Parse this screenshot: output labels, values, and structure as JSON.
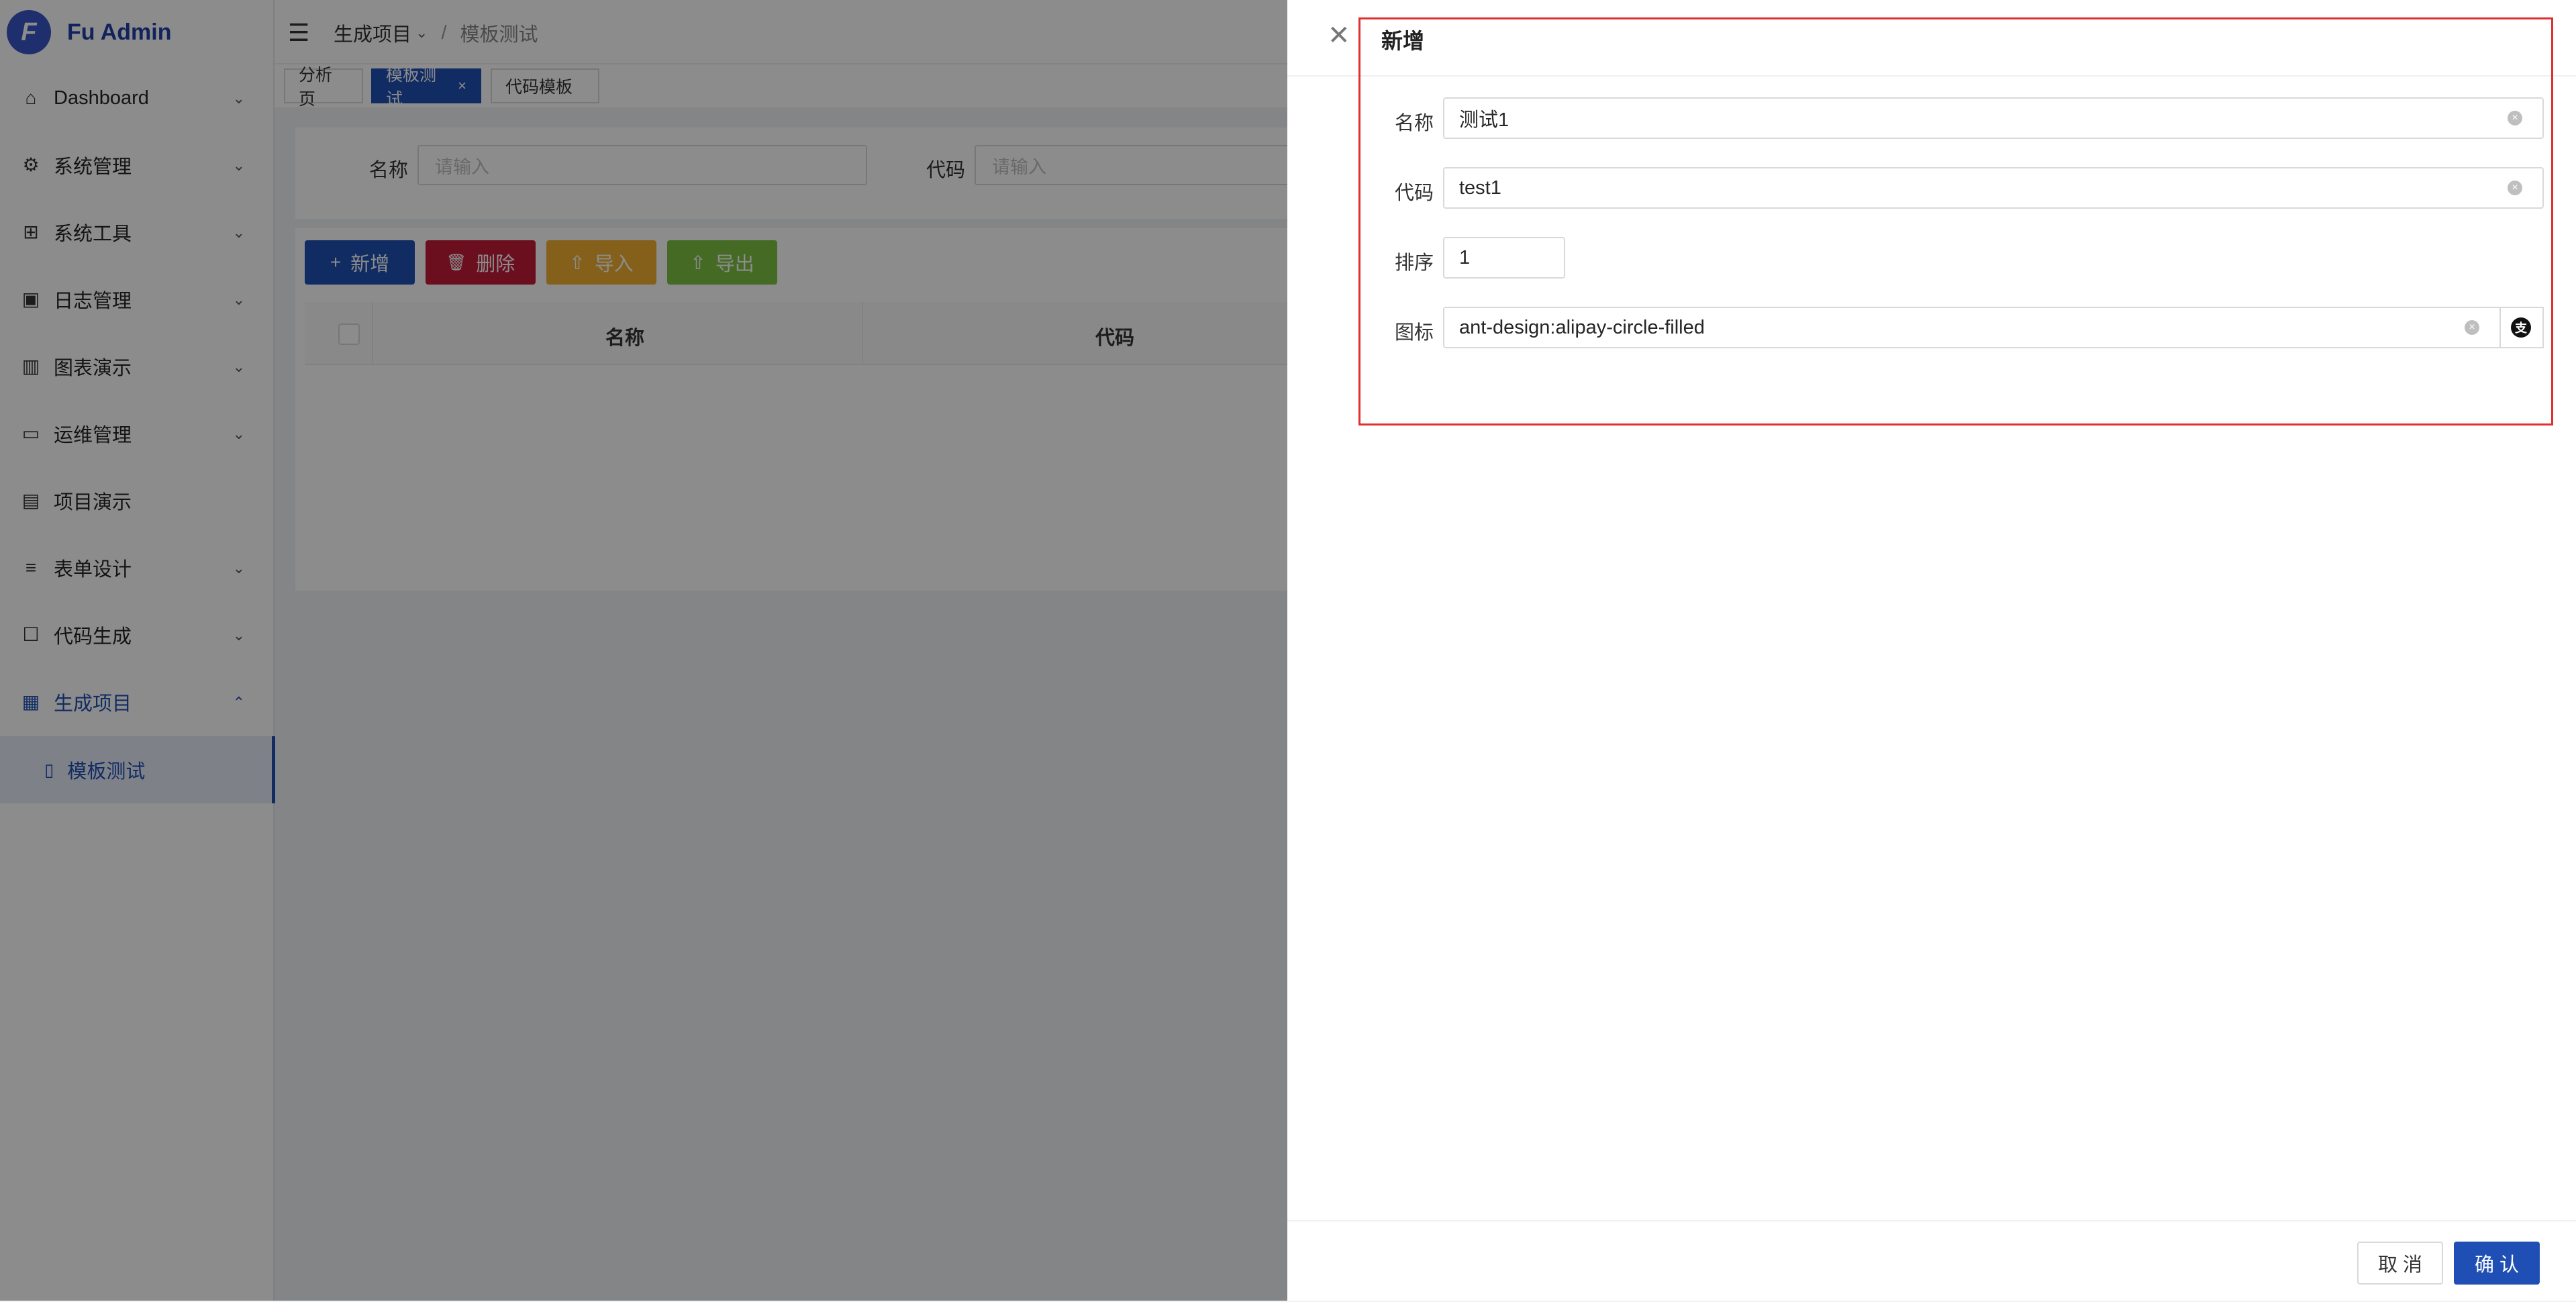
{
  "app": {
    "logo_letter": "F",
    "title": "Fu Admin"
  },
  "sidebar": {
    "items": [
      {
        "label": "Dashboard",
        "icon": "home-icon",
        "glyph": "⌂",
        "arrow": "⌄"
      },
      {
        "label": "系统管理",
        "icon": "gear-icon",
        "glyph": "⚙",
        "arrow": "⌄"
      },
      {
        "label": "系统工具",
        "icon": "grid-icon",
        "glyph": "⊞",
        "arrow": "⌄"
      },
      {
        "label": "日志管理",
        "icon": "terminal-icon",
        "glyph": "▣",
        "arrow": "⌄"
      },
      {
        "label": "图表演示",
        "icon": "bar-chart-icon",
        "glyph": "▥",
        "arrow": "⌄"
      },
      {
        "label": "运维管理",
        "icon": "monitor-icon",
        "glyph": "▭",
        "arrow": "⌄"
      },
      {
        "label": "项目演示",
        "icon": "document-icon",
        "glyph": "▤",
        "arrow": ""
      },
      {
        "label": "表单设计",
        "icon": "align-left-icon",
        "glyph": "≡",
        "arrow": "⌄"
      },
      {
        "label": "代码生成",
        "icon": "square-icon",
        "glyph": "☐",
        "arrow": "⌄"
      },
      {
        "label": "生成项目",
        "icon": "project-icon",
        "glyph": "▦",
        "arrow": "⌃"
      }
    ],
    "active_sub": {
      "label": "模板测试",
      "icon": "file-icon",
      "glyph": "▯"
    }
  },
  "header": {
    "fold_glyph": "☰",
    "breadcrumb": [
      "生成项目",
      "模板测试"
    ],
    "breadcrumb_arrow": "⌄",
    "breadcrumb_sep": "/"
  },
  "tabs": [
    {
      "label": "分析页"
    },
    {
      "label": "模板测试",
      "close": "×"
    },
    {
      "label": "代码模板"
    }
  ],
  "search": {
    "name_label": "名称",
    "name_placeholder": "请输入",
    "code_label": "代码",
    "code_placeholder": "请输入"
  },
  "toolbar": {
    "add": {
      "label": "新增",
      "glyph": "+"
    },
    "delete": {
      "label": "删除",
      "glyph": "🗑"
    },
    "import": {
      "label": "导入",
      "glyph": "⇧"
    },
    "export": {
      "label": "导出",
      "glyph": "⇧"
    }
  },
  "table": {
    "columns": [
      "名称",
      "代码"
    ]
  },
  "drawer": {
    "close_glyph": "✕",
    "title": "新增",
    "form": {
      "name": {
        "label": "名称",
        "value": "测试1"
      },
      "code": {
        "label": "代码",
        "value": "test1"
      },
      "sort": {
        "label": "排序",
        "value": "1"
      },
      "icon": {
        "label": "图标",
        "value": "ant-design:alipay-circle-filled",
        "preview": "支"
      }
    },
    "clear_glyph": "×",
    "cancel_label": "取 消",
    "confirm_label": "确 认"
  },
  "colors": {
    "primary": "#1f4fb4",
    "danger": "#c41d3a",
    "warning": "#f0b030",
    "success": "#7cc242",
    "highlight": "#e02f2f"
  }
}
